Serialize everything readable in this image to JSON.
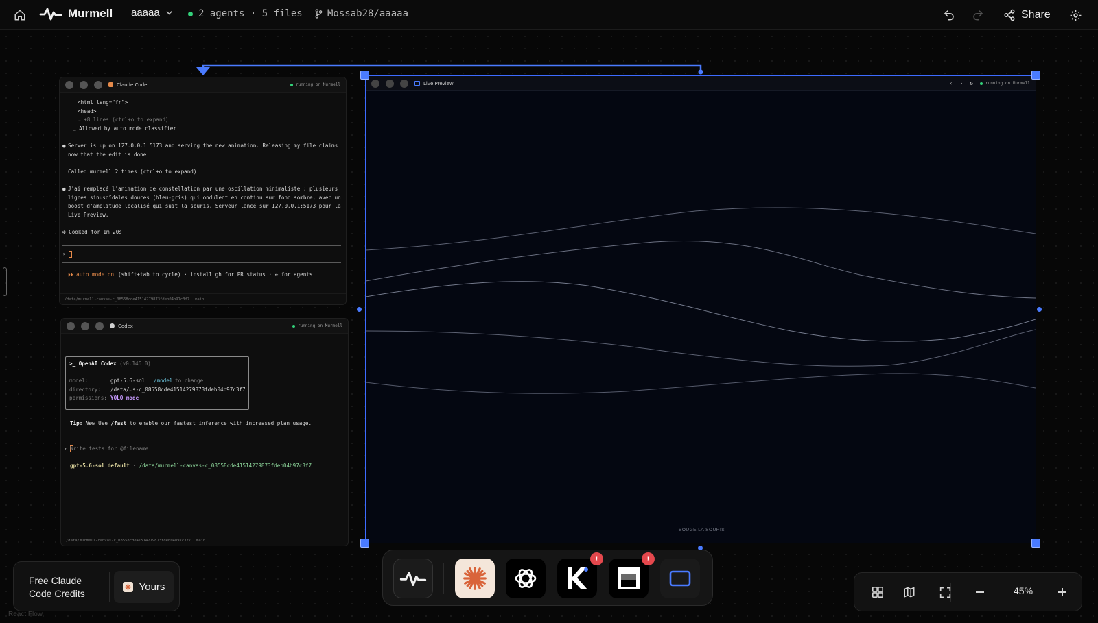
{
  "topbar": {
    "app_name": "Murmell",
    "project_name": "aaaaa",
    "status": "2 agents · 5 files",
    "repo": "Mossab28/aaaaa",
    "share_label": "Share"
  },
  "claude_panel": {
    "title": "Claude Code",
    "status": "running on Murmell",
    "lines": [
      "<html lang=\"fr\">",
      "<head>",
      "… +8 lines (ctrl+o to expand)",
      "⎿ Allowed by auto mode classifier",
      "Server is up on 127.0.0.1:5173 and serving the new animation. Releasing my file claims",
      "now that the edit is done.",
      "Called murmell 2 times (ctrl+o to expand)",
      "J'ai remplacé l'animation de constellation par une oscillation minimaliste : plusieurs",
      "lignes sinusoïdales douces (bleu-gris) qui ondulent en continu sur fond sombre, avec un",
      "boost d'amplitude localisé qui suit la souris. Serveur lancé sur 127.0.0.1:5173 pour la",
      "Live Preview.",
      "✻ Cooked for 1m 20s"
    ],
    "prompt": "›",
    "mode_hint_prefix": "⏵⏵ auto mode on",
    "mode_hint_rest": "(shift+tab to cycle) · install gh for PR status · ← for agents",
    "footer_path": "/data/murmell-canvas-c_08558cde41514279873fdeb04b97c3f7",
    "footer_branch": "main"
  },
  "codex_panel": {
    "title": "Codex",
    "status": "running on Murmell",
    "box_title": ">_ OpenAI Codex",
    "box_version": "(v0.146.0)",
    "model_label": "model:",
    "model_value": "gpt-5.6-sol",
    "model_hint_cmd": "/model",
    "model_hint_rest": "to change",
    "directory_label": "directory:",
    "directory_value": "/data/…s-c_08558cde41514279873fdeb04b97c3f7",
    "permissions_label": "permissions:",
    "permissions_value": "YOLO mode",
    "tip_label": "Tip:",
    "tip_new": "New",
    "tip_use": "Use",
    "tip_cmd": "/fast",
    "tip_rest": "to enable our fastest inference with increased plan usage.",
    "input_placeholder": "Write tests for @filename",
    "model_line_model": "gpt-5.6-sol default",
    "model_line_path": "/data/murmell-canvas-c_08558cde41514279873fdeb04b97c3f7",
    "footer_path": "/data/murmell-canvas-c_08558cde41514279873fdeb04b97c3f7",
    "footer_branch": "main"
  },
  "preview_panel": {
    "title": "Live Preview",
    "status": "running on Murmell",
    "caption": "BOUGE LA SOURIS"
  },
  "credits": {
    "text": "Free Claude Code Credits",
    "yours_label": "Yours"
  },
  "dock": {
    "items": [
      "murmell",
      "claude",
      "openai",
      "kimi",
      "notion",
      "new-window"
    ],
    "badge": "!"
  },
  "zoom": {
    "value": "45%"
  },
  "watermark": "React Flow",
  "colors": {
    "accent": "#4a7bff",
    "running": "#33d17a",
    "alert": "#e5484d",
    "claude_orange": "#e58a4a"
  }
}
